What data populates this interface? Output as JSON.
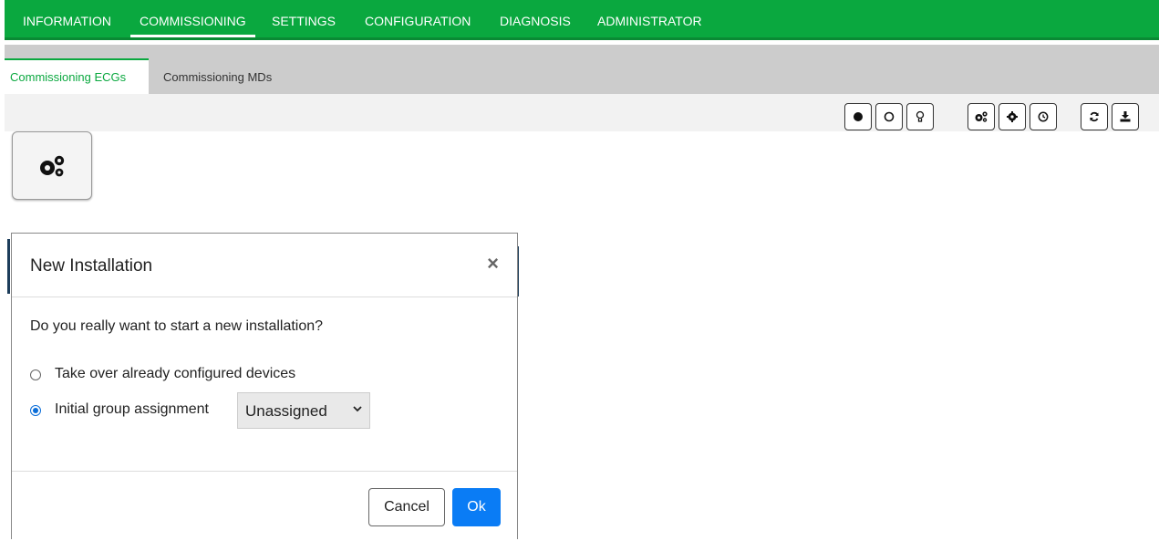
{
  "nav": {
    "items": [
      {
        "label": "INFORMATION"
      },
      {
        "label": "COMMISSIONING"
      },
      {
        "label": "SETTINGS"
      },
      {
        "label": "CONFIGURATION"
      },
      {
        "label": "DIAGNOSIS"
      },
      {
        "label": "ADMINISTRATOR"
      }
    ],
    "active": "COMMISSIONING"
  },
  "subtabs": {
    "items": [
      {
        "label": "Commissioning ECGs"
      },
      {
        "label": "Commissioning MDs"
      }
    ],
    "active": "Commissioning ECGs"
  },
  "toolbar": {
    "icons": [
      "filled-circle-icon",
      "empty-circle-icon",
      "lightbulb-icon",
      "gears-icon",
      "gear-icon",
      "clock-icon",
      "refresh-icon",
      "download-icon"
    ]
  },
  "main": {
    "big_button_icon": "gears-icon"
  },
  "modal": {
    "title": "New Installation",
    "close": "×",
    "question": "Do you really want to start a new installation?",
    "option_takeover": "Take over already configured devices",
    "option_initial": "Initial group assignment",
    "selected_option": "Initial group assignment",
    "group_select_value": "Unassigned",
    "cancel_label": "Cancel",
    "ok_label": "Ok"
  },
  "colors": {
    "nav_bg": "#0aa83f",
    "accent_blue": "#0a7cf5",
    "subtab_bg": "#cccccc"
  }
}
